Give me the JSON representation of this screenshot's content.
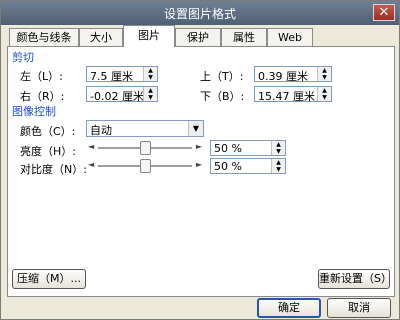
{
  "window": {
    "title": "设置图片格式",
    "close_glyph": "✕"
  },
  "tabs": [
    {
      "label": "颜色与线条"
    },
    {
      "label": "大小"
    },
    {
      "label": "图片"
    },
    {
      "label": "保护"
    },
    {
      "label": "属性"
    },
    {
      "label": "Web"
    }
  ],
  "crop": {
    "section_label": "剪切",
    "left_label": "左（L）:",
    "left_value": "7.5 厘米",
    "right_label": "右（R）:",
    "right_value": "-0.02 厘米",
    "top_label": "上（T）:",
    "top_value": "0.39 厘米",
    "bottom_label": "下（B）:",
    "bottom_value": "15.47 厘米"
  },
  "image_control": {
    "section_label": "图像控制",
    "color_label": "颜色（C）:",
    "color_value": "自动",
    "brightness_label": "亮度（H）:",
    "brightness_value": "50 %",
    "brightness_level": 0.5,
    "contrast_label": "对比度（N）:",
    "contrast_value": "50 %",
    "contrast_level": 0.5
  },
  "buttons": {
    "compress": "压缩（M）...",
    "reset": "重新设置（S）",
    "ok": "确定",
    "cancel": "取消"
  }
}
